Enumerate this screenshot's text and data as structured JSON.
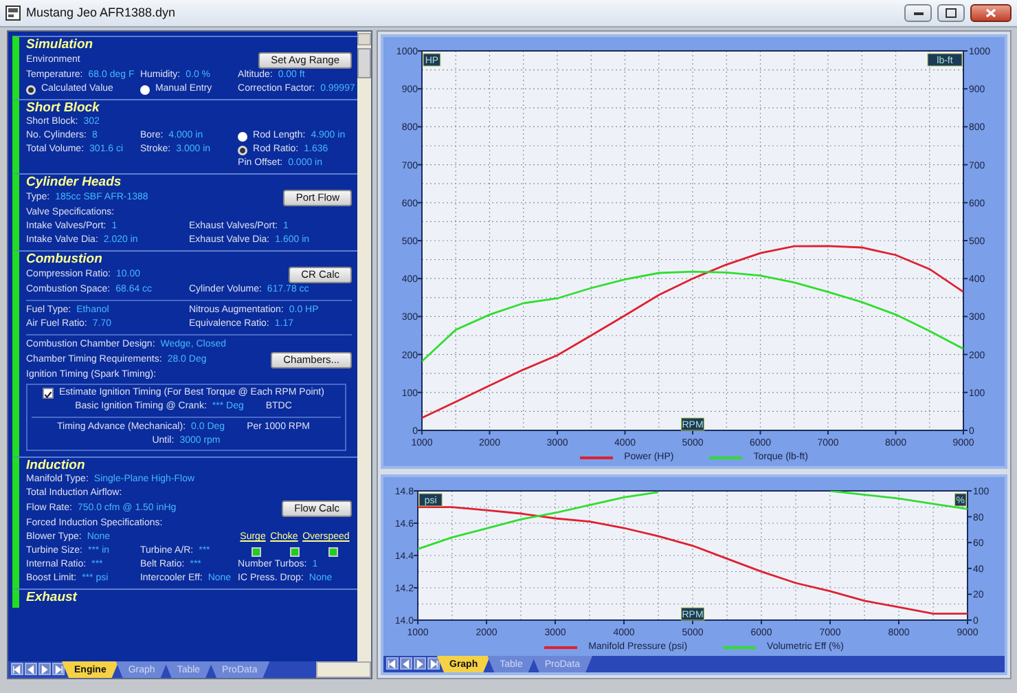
{
  "window": {
    "title": "Mustang Jeo AFR1388.dyn"
  },
  "engine_panel": {
    "sections": [
      {
        "title": "Simulation",
        "lines": [
          {
            "kind": "line",
            "cells": [
              {
                "kind": "text",
                "text": "Environment"
              }
            ],
            "button": "Set Avg Range"
          },
          {
            "kind": "line",
            "cells": [
              {
                "kind": "field",
                "label": "Temperature:",
                "value": "68.0 deg F"
              },
              {
                "kind": "field",
                "label": "Humidity:",
                "value": "0.0 %"
              },
              {
                "kind": "field",
                "label": "Altitude:",
                "value": "0.00 ft"
              }
            ]
          },
          {
            "kind": "line",
            "cells": [
              {
                "kind": "radio",
                "label": "Calculated Value",
                "selected": true
              },
              {
                "kind": "radio",
                "label": "Manual Entry",
                "selected": false
              },
              {
                "kind": "field",
                "label": "Correction Factor:",
                "value": "0.99997"
              }
            ]
          }
        ]
      },
      {
        "title": "Short Block",
        "lines": [
          {
            "kind": "line",
            "cells": [
              {
                "kind": "field",
                "label": "Short Block:",
                "value": "302"
              }
            ]
          },
          {
            "kind": "line",
            "cells": [
              {
                "kind": "field",
                "label": "No. Cylinders:",
                "value": "8"
              },
              {
                "kind": "field",
                "label": "Bore:",
                "value": "4.000 in"
              },
              {
                "kind": "radio",
                "label": "Rod Length:",
                "value": "4.900 in",
                "selected": false
              }
            ]
          },
          {
            "kind": "line",
            "cells": [
              {
                "kind": "field",
                "label": "Total Volume:",
                "value": "301.6 ci"
              },
              {
                "kind": "field",
                "label": "Stroke:",
                "value": "3.000 in"
              },
              {
                "kind": "radio",
                "label": "Rod Ratio:",
                "value": "1.636",
                "selected": true
              }
            ]
          },
          {
            "kind": "trailing",
            "cells": [
              {
                "kind": "field",
                "label": "Pin Offset:",
                "value": "0.000 in"
              }
            ]
          }
        ]
      },
      {
        "title": "Cylinder Heads",
        "lines": [
          {
            "kind": "line",
            "cells": [
              {
                "kind": "field",
                "label": "Type:",
                "value": "185cc SBF AFR-1388"
              }
            ],
            "button": "Port Flow"
          },
          {
            "kind": "line",
            "cells": [
              {
                "kind": "text",
                "text": "Valve Specifications:"
              }
            ]
          },
          {
            "kind": "line",
            "cells": [
              {
                "kind": "field",
                "label": "Intake Valves/Port:",
                "value": "1"
              },
              {
                "kind": "field",
                "label": "Exhaust Valves/Port:",
                "value": "1"
              }
            ]
          },
          {
            "kind": "line",
            "cells": [
              {
                "kind": "field",
                "label": "Intake Valve Dia:",
                "value": "2.020 in"
              },
              {
                "kind": "field",
                "label": "Exhaust Valve Dia:",
                "value": "1.600 in"
              }
            ]
          }
        ]
      },
      {
        "title": "Combustion",
        "lines": [
          {
            "kind": "line",
            "cells": [
              {
                "kind": "field",
                "label": "Compression Ratio:",
                "value": "10.00"
              }
            ],
            "button": "CR Calc"
          },
          {
            "kind": "line",
            "cells": [
              {
                "kind": "field",
                "label": "Combustion Space:",
                "value": "68.64 cc"
              },
              {
                "kind": "field",
                "label": "Cylinder Volume:",
                "value": "617.78 cc"
              }
            ]
          },
          {
            "kind": "divider"
          },
          {
            "kind": "line",
            "cells": [
              {
                "kind": "field",
                "label": "Fuel Type:",
                "value": "Ethanol"
              },
              {
                "kind": "field",
                "label": "Nitrous Augmentation:",
                "value": "0.0 HP"
              }
            ]
          },
          {
            "kind": "line",
            "cells": [
              {
                "kind": "field",
                "label": "Air Fuel Ratio:",
                "value": "7.70"
              },
              {
                "kind": "field",
                "label": "Equivalence Ratio:",
                "value": "1.17"
              }
            ]
          },
          {
            "kind": "divider"
          },
          {
            "kind": "line",
            "cells": [
              {
                "kind": "field",
                "label": "Combustion Chamber Design:",
                "value": "Wedge, Closed"
              }
            ]
          },
          {
            "kind": "line",
            "cells": [
              {
                "kind": "field",
                "label": "Chamber Timing Requirements:",
                "value": "28.0 Deg"
              }
            ],
            "button": "Chambers..."
          },
          {
            "kind": "line",
            "cells": [
              {
                "kind": "text",
                "text": "Ignition Timing (Spark Timing):"
              }
            ]
          },
          {
            "kind": "box",
            "lines": [
              {
                "kind": "line",
                "cells": [
                  {
                    "kind": "checkbox",
                    "label": "Estimate Ignition Timing (For Best Torque @ Each RPM Point)",
                    "checked": true
                  }
                ]
              },
              {
                "kind": "line",
                "cells": [
                  {
                    "kind": "field",
                    "label": "Basic Ignition Timing @ Crank:",
                    "value": "*** Deg",
                    "unit": "BTDC"
                  }
                ]
              },
              {
                "kind": "divider"
              },
              {
                "kind": "line",
                "cells": [
                  {
                    "kind": "field",
                    "label": "Timing Advance (Mechanical):",
                    "value": "0.0 Deg",
                    "unit": "Per 1000 RPM"
                  }
                ]
              },
              {
                "kind": "line",
                "cells": [
                  {
                    "kind": "field",
                    "label": "Until:",
                    "value": "3000 rpm"
                  }
                ]
              }
            ]
          }
        ]
      },
      {
        "title": "Induction",
        "lines": [
          {
            "kind": "line",
            "cells": [
              {
                "kind": "field",
                "label": "Manifold Type:",
                "value": "Single-Plane High-Flow"
              }
            ]
          },
          {
            "kind": "line",
            "cells": [
              {
                "kind": "text",
                "text": "Total Induction Airflow:"
              }
            ]
          },
          {
            "kind": "line",
            "cells": [
              {
                "kind": "field",
                "label": "Flow Rate:",
                "value": "750.0 cfm @ 1.50 inHg"
              }
            ],
            "button": "Flow Calc"
          },
          {
            "kind": "line",
            "cells": [
              {
                "kind": "text",
                "text": "Forced Induction Specifications:"
              }
            ]
          },
          {
            "kind": "line",
            "cells": [
              {
                "kind": "field",
                "label": "Blower Type:",
                "value": "None"
              },
              {
                "kind": "flags",
                "items": [
                  {
                    "label": "Surge"
                  },
                  {
                    "label": "Choke"
                  },
                  {
                    "label": "Overspeed"
                  }
                ]
              }
            ]
          },
          {
            "kind": "line",
            "cells": [
              {
                "kind": "field",
                "label": "Turbine Size:",
                "value": "*** in"
              },
              {
                "kind": "field",
                "label": "Turbine A/R:",
                "value": "***"
              },
              {
                "kind": "lights",
                "items": [
                  {
                    "on": true
                  },
                  {
                    "on": true
                  },
                  {
                    "on": true
                  }
                ]
              }
            ]
          },
          {
            "kind": "line",
            "cells": [
              {
                "kind": "field",
                "label": "Internal Ratio:",
                "value": "***"
              },
              {
                "kind": "field",
                "label": "Belt Ratio:",
                "value": "***"
              },
              {
                "kind": "field",
                "label": "Number Turbos:",
                "value": "1"
              }
            ]
          },
          {
            "kind": "line",
            "cells": [
              {
                "kind": "field",
                "label": "Boost Limit:",
                "value": "*** psi"
              },
              {
                "kind": "field",
                "label": "Intercooler Eff:",
                "value": "None"
              },
              {
                "kind": "field",
                "label": "IC Press. Drop:",
                "value": "None"
              }
            ]
          }
        ]
      },
      {
        "title": "Exhaust"
      }
    ]
  },
  "engine_tabs": [
    {
      "label": "Engine",
      "selected": true
    },
    {
      "label": "Graph",
      "selected": false
    },
    {
      "label": "Table",
      "selected": false
    },
    {
      "label": "ProData",
      "selected": false
    }
  ],
  "charts": [
    {
      "chart_data": {
        "type": "line",
        "grid": true,
        "legend": "bottom",
        "xlabel": "RPM",
        "ylabel": "HP",
        "y2label": "lb-ft",
        "x": [
          1000,
          1500,
          2000,
          2500,
          3000,
          3500,
          4000,
          4500,
          5000,
          5500,
          6000,
          6500,
          7000,
          7500,
          8000,
          8500,
          9000
        ],
        "xlim": [
          1000,
          9000
        ],
        "ylim": [
          0,
          1000
        ],
        "y2lim": [
          0,
          1000
        ],
        "xticks": [
          1000,
          2000,
          3000,
          4000,
          5000,
          6000,
          7000,
          8000,
          9000
        ],
        "yticks": [
          0,
          100,
          200,
          300,
          400,
          500,
          600,
          700,
          800,
          900,
          1000
        ],
        "y2ticks": [
          0,
          100,
          200,
          300,
          400,
          500,
          600,
          700,
          800,
          900,
          1000
        ],
        "series": [
          {
            "name": "Power (HP)",
            "color": "#e02030",
            "values": [
              33,
              75,
              118,
              160,
              198,
              250,
              303,
              357,
              400,
              437,
              467,
              485,
              486,
              482,
              462,
              425,
              365
            ]
          },
          {
            "name": "Torque (lb-ft)",
            "color": "#30dd30",
            "axis": "y2",
            "values": [
              182,
              265,
              305,
              335,
              348,
              375,
              398,
              415,
              418,
              416,
              408,
              390,
              365,
              338,
              305,
              262,
              215
            ]
          }
        ]
      }
    },
    {
      "chart_data": {
        "type": "line",
        "grid": true,
        "legend": "bottom",
        "xlabel": "RPM",
        "ylabel": "psi",
        "y2label": "%",
        "x": [
          1000,
          1500,
          2000,
          2500,
          3000,
          3500,
          4000,
          4500,
          5000,
          5500,
          6000,
          6500,
          7000,
          7500,
          8000,
          8500,
          9000
        ],
        "xlim": [
          1000,
          9000
        ],
        "ylim": [
          14.0,
          14.8
        ],
        "y2lim": [
          0,
          100
        ],
        "xticks": [
          1000,
          2000,
          3000,
          4000,
          5000,
          6000,
          7000,
          8000,
          9000
        ],
        "yticks": [
          {
            "value": 14.0,
            "label": "14.0"
          },
          {
            "value": 14.2,
            "label": "14.2"
          },
          {
            "value": 14.4,
            "label": "14.4"
          },
          {
            "value": 14.6,
            "label": "14.6"
          },
          {
            "value": 14.8,
            "label": "14.8"
          }
        ],
        "y2ticks": [
          0,
          20,
          40,
          60,
          80,
          100
        ],
        "series": [
          {
            "name": "Manifold Pressure (psi)",
            "color": "#e02030",
            "values": [
              14.7,
              14.7,
              14.68,
              14.66,
              14.63,
              14.61,
              14.57,
              14.52,
              14.46,
              14.38,
              14.3,
              14.23,
              14.18,
              14.12,
              14.08,
              14.04,
              14.04
            ]
          },
          {
            "name": "Volumetric Eff (%)",
            "color": "#30dd30",
            "axis": "y2",
            "values": [
              55,
              64,
              71,
              78,
              83,
              89,
              95,
              99,
              null,
              null,
              null,
              null,
              100,
              97,
              94,
              90,
              86
            ]
          }
        ]
      }
    }
  ],
  "graph_tabs": [
    {
      "label": "Graph",
      "selected": true
    },
    {
      "label": "Table",
      "selected": false
    },
    {
      "label": "ProData",
      "selected": false
    }
  ]
}
